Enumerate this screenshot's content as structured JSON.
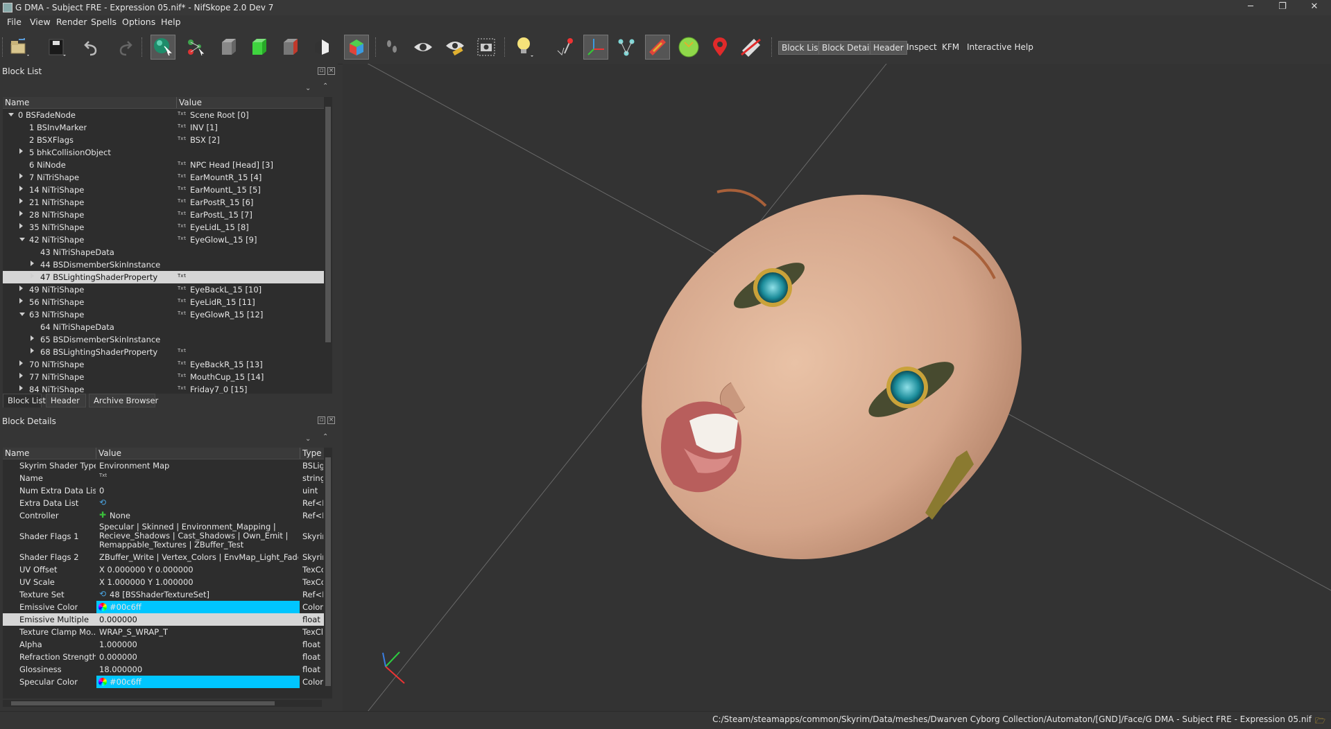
{
  "window": {
    "title": "G DMA - Subject FRE - Expression 05.nif* - NifSkope 2.0 Dev 7",
    "minimize": "─",
    "restore": "❐",
    "close": "✕"
  },
  "menu": [
    "File",
    "View",
    "Render",
    "Spells",
    "Options",
    "Help"
  ],
  "toolbar": {
    "text_buttons": [
      "Block List",
      "Block Details",
      "Header",
      "Inspect",
      "KFM",
      "Interactive Help"
    ],
    "icons": [
      "load-icon",
      "save-icon",
      "undo-icon",
      "redo-icon",
      "sphere-select-icon",
      "nodes-icon",
      "cube-gray-icon",
      "cube-green-icon",
      "cube-gray2-icon",
      "split-cube-icon",
      "color-cube-icon",
      "footprints-icon",
      "eye-icon",
      "eye-tool-icon",
      "camera-icon",
      "lightbulb-icon",
      "marker-icon",
      "axes-icon",
      "vertices-icon",
      "mesh-highlight-icon",
      "green-circle-icon",
      "location-pin-icon",
      "no-draw-icon"
    ]
  },
  "block_list": {
    "title": "Block List",
    "columns": [
      "Name",
      "Value"
    ],
    "rows": [
      {
        "name": "0 BSFadeNode",
        "value": "Scene Root [0]",
        "indent": 0,
        "arrow": "down",
        "txt": true
      },
      {
        "name": "1 BSInvMarker",
        "value": "INV [1]",
        "indent": 1,
        "arrow": "",
        "txt": true
      },
      {
        "name": "2 BSXFlags",
        "value": "BSX [2]",
        "indent": 1,
        "arrow": "",
        "txt": true
      },
      {
        "name": "5 bhkCollisionObject",
        "value": "",
        "indent": 1,
        "arrow": "right",
        "txt": false
      },
      {
        "name": "6 NiNode",
        "value": "NPC Head [Head] [3]",
        "indent": 1,
        "arrow": "",
        "txt": true
      },
      {
        "name": "7 NiTriShape",
        "value": "EarMountR_15 [4]",
        "indent": 1,
        "arrow": "right",
        "txt": true
      },
      {
        "name": "14 NiTriShape",
        "value": "EarMountL_15 [5]",
        "indent": 1,
        "arrow": "right",
        "txt": true
      },
      {
        "name": "21 NiTriShape",
        "value": "EarPostR_15 [6]",
        "indent": 1,
        "arrow": "right",
        "txt": true
      },
      {
        "name": "28 NiTriShape",
        "value": "EarPostL_15 [7]",
        "indent": 1,
        "arrow": "right",
        "txt": true
      },
      {
        "name": "35 NiTriShape",
        "value": "EyeLidL_15 [8]",
        "indent": 1,
        "arrow": "right",
        "txt": true
      },
      {
        "name": "42 NiTriShape",
        "value": "EyeGlowL_15 [9]",
        "indent": 1,
        "arrow": "down",
        "txt": true
      },
      {
        "name": "43 NiTriShapeData",
        "value": "",
        "indent": 2,
        "arrow": "",
        "txt": false
      },
      {
        "name": "44 BSDismemberSkinInstance",
        "value": "",
        "indent": 2,
        "arrow": "right",
        "txt": false
      },
      {
        "name": "47 BSLightingShaderProperty",
        "value": "",
        "indent": 2,
        "arrow": "right",
        "txt": true,
        "selected": true
      },
      {
        "name": "49 NiTriShape",
        "value": "EyeBackL_15 [10]",
        "indent": 1,
        "arrow": "right",
        "txt": true
      },
      {
        "name": "56 NiTriShape",
        "value": "EyeLidR_15 [11]",
        "indent": 1,
        "arrow": "right",
        "txt": true
      },
      {
        "name": "63 NiTriShape",
        "value": "EyeGlowR_15 [12]",
        "indent": 1,
        "arrow": "down",
        "txt": true
      },
      {
        "name": "64 NiTriShapeData",
        "value": "",
        "indent": 2,
        "arrow": "",
        "txt": false
      },
      {
        "name": "65 BSDismemberSkinInstance",
        "value": "",
        "indent": 2,
        "arrow": "right",
        "txt": false
      },
      {
        "name": "68 BSLightingShaderProperty",
        "value": "",
        "indent": 2,
        "arrow": "right",
        "txt": true
      },
      {
        "name": "70 NiTriShape",
        "value": "EyeBackR_15 [13]",
        "indent": 1,
        "arrow": "right",
        "txt": true
      },
      {
        "name": "77 NiTriShape",
        "value": "MouthCup_15 [14]",
        "indent": 1,
        "arrow": "right",
        "txt": true
      },
      {
        "name": "84 NiTriShape",
        "value": "Friday7_0 [15]",
        "indent": 1,
        "arrow": "right",
        "txt": true
      }
    ],
    "tabs": [
      "Block List",
      "Header",
      "Archive Browser"
    ]
  },
  "block_details": {
    "title": "Block Details",
    "columns": [
      "Name",
      "Value",
      "Type"
    ],
    "rows": [
      {
        "name": "Skyrim Shader Type",
        "value": "Environment Map",
        "type": "BSLig"
      },
      {
        "name": "Name",
        "value": "",
        "type": "string",
        "icon": "txt"
      },
      {
        "name": "Num Extra Data List",
        "value": "0",
        "type": "uint"
      },
      {
        "name": "Extra Data List",
        "value": "",
        "type": "Ref<N",
        "icon": "link"
      },
      {
        "name": "Controller",
        "value": "None",
        "type": "Ref<N",
        "icon": "plus"
      },
      {
        "name": "Shader Flags 1",
        "value": "Specular | Skinned | Environment_Mapping |\nRecieve_Shadows | Cast_Shadows | Own_Emit |\nRemappable_Textures | ZBuffer_Test",
        "type": "Skyrir",
        "tall": true
      },
      {
        "name": "Shader Flags 2",
        "value": "ZBuffer_Write | Vertex_Colors | EnvMap_Light_Fade",
        "type": "Skyrir"
      },
      {
        "name": "UV Offset",
        "value": "X 0.000000 Y 0.000000",
        "type": "TexCo"
      },
      {
        "name": "UV Scale",
        "value": "X 1.000000 Y 1.000000",
        "type": "TexCo"
      },
      {
        "name": "Texture Set",
        "value": "48 [BSShaderTextureSet]",
        "type": "Ref<E",
        "icon": "link"
      },
      {
        "name": "Emissive Color",
        "value": "#00c6ff",
        "type": "Color",
        "color": "#00c6ff"
      },
      {
        "name": "Emissive Multiple",
        "value": "0.000000",
        "type": "float",
        "selected": true
      },
      {
        "name": "Texture Clamp Mo...",
        "value": "WRAP_S_WRAP_T",
        "type": "TexCl"
      },
      {
        "name": "Alpha",
        "value": "1.000000",
        "type": "float"
      },
      {
        "name": "Refraction Strength",
        "value": "0.000000",
        "type": "float"
      },
      {
        "name": "Glossiness",
        "value": "18.000000",
        "type": "float"
      },
      {
        "name": "Specular Color",
        "value": "#00c6ff",
        "type": "Color",
        "color": "#00c6ff"
      }
    ]
  },
  "status": {
    "path": "C:/Steam/steamapps/common/Skyrim/Data/meshes/Dwarven Cyborg Collection/Automaton/[GND]/Face/G DMA - Subject FRE - Expression 05.nif"
  }
}
